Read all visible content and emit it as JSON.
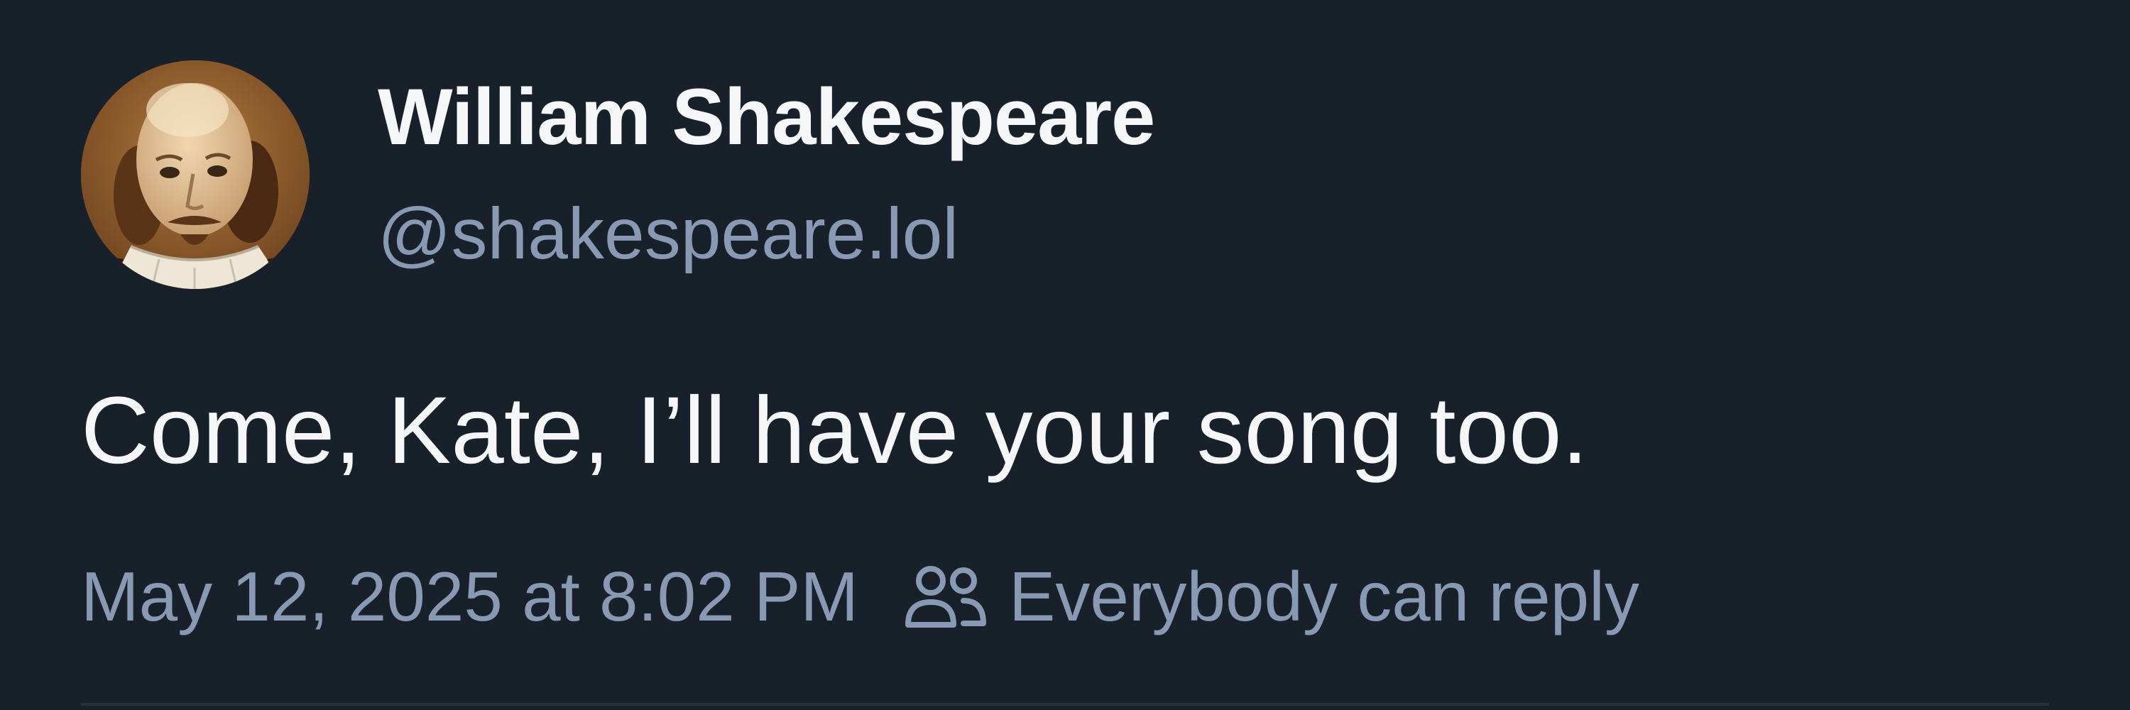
{
  "post": {
    "author": {
      "display_name": "William Shakespeare",
      "handle": "@shakespeare.lol",
      "avatar_icon": "portrait-avatar"
    },
    "text": "Come, Kate, I’ll have your song too.",
    "timestamp": "May 12, 2025 at 8:02 PM",
    "reply_setting": {
      "icon": "people-icon",
      "label": "Everybody can reply"
    }
  },
  "colors": {
    "background": "#18202a",
    "primary_text": "#f4f6f8",
    "secondary_text": "#8799b3",
    "divider": "#27313e"
  }
}
